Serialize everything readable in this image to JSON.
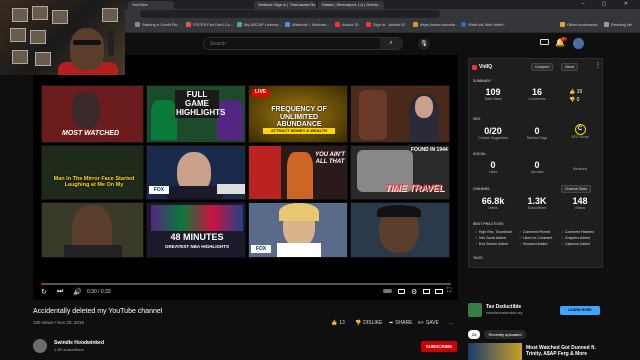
{
  "browser": {
    "tabs": [
      "YouTube",
      "Webinar Sign in | Thomasina Ro...",
      "Dallas | Shreveport, LA | Global...",
      ""
    ],
    "bookmarks": [
      {
        "label": "Starting a Credit Re...",
        "color": "#888"
      },
      {
        "label": "FDCPA Fair Debt Co...",
        "color": "#d55"
      },
      {
        "label": "My ASCAP License...",
        "color": "#4a8"
      },
      {
        "label": "Webmail :: Welcom...",
        "color": "#58c"
      },
      {
        "label": "Adobe ID",
        "color": "#e33"
      },
      {
        "label": "Sign in - Adobe ID",
        "color": "#e33"
      },
      {
        "label": "https://www.cfsonlin...",
        "color": "#c93"
      },
      {
        "label": "WebLink Web Interf...",
        "color": "#36a"
      },
      {
        "label": "Other bookmarks",
        "color": "#d9a441"
      },
      {
        "label": "Reading list",
        "color": "#999"
      }
    ]
  },
  "youtube": {
    "search_placeholder": "Search",
    "notif_count": "9+",
    "video": {
      "title": "Accidentally deleted my YouTube channel",
      "meta": "100 views • Nov 20, 2019",
      "time": "0:30 / 0:33",
      "likes": "13",
      "dislike_label": "DISLIKE",
      "share_label": "SHARE",
      "save_label": "SAVE",
      "more_label": "..."
    },
    "channel": {
      "name": "Swindle Hoodwinked",
      "subs": "1.5K subscribers"
    },
    "subscribe_label": "SUBSCRIBE"
  },
  "thumbnails": [
    {
      "text": "MOST WATCHED",
      "bg": "#6b1d1d",
      "color": "#fff"
    },
    {
      "text": "FULL GAME HIGHLIGHTS",
      "bg": "#1d4a2a",
      "color": "#fff"
    },
    {
      "text": "LIVE",
      "sub": "FREQUENCY OF UNLIMITED ABUNDANCE",
      "sub2": "ATTRACT MONEY & WEALTH",
      "bg": "#3a2a00",
      "color": "#ffd700"
    },
    {
      "text": "",
      "bg": "#4a2a1a",
      "color": "#fff"
    },
    {
      "text": "Man In The Mirror Face Started Laughing at Me On My",
      "bg": "#1f2a1a",
      "color": "#ffd700"
    },
    {
      "text": "",
      "bg": "#1a2a4a",
      "color": "#fff"
    },
    {
      "text": "YOU AIN'T ALL THAT",
      "bg": "#2a1a1a",
      "color": "#fff"
    },
    {
      "text": "TIME TRAVEL",
      "sub": "FOUND IN 1944",
      "bg": "#2a2a2a",
      "color": "#e33"
    },
    {
      "text": "",
      "bg": "#3a3a2a",
      "color": "#fff"
    },
    {
      "text": "48 MINUTES",
      "sub": "GREATEST NBA HIGHLIGHTS",
      "bg": "#1a1a2a",
      "color": "#fff"
    },
    {
      "text": "",
      "bg": "#4a4a5a",
      "color": "#fff"
    },
    {
      "text": "",
      "bg": "#2a3a4a",
      "color": "#fff"
    }
  ],
  "vidiq": {
    "brand": "VidIQ",
    "btn_compare": "Compare",
    "btn_views": "Views",
    "summary_label": "SUMMARY",
    "summary": [
      {
        "value": "109",
        "cap": "Total Views"
      },
      {
        "value": "16",
        "cap": "Comments"
      },
      {
        "value": "19",
        "cap": ""
      }
    ],
    "seo_label": "SEO",
    "seo": [
      {
        "value": "0/20",
        "cap": "Creator Suggested"
      },
      {
        "value": "0",
        "cap": "Ranked Tags"
      },
      {
        "value": "C",
        "cap": "SEO Score"
      }
    ],
    "social_label": "SOCIAL",
    "social": [
      {
        "value": "0",
        "cap": "Likes"
      },
      {
        "value": "0",
        "cap": "Upvotes"
      },
      {
        "value": "",
        "cap": "Mentions"
      }
    ],
    "channel_label": "CHANNEL",
    "channel_btn": "Channel Stats",
    "channel": [
      {
        "value": "66.8k",
        "cap": "Views"
      },
      {
        "value": "1.3K",
        "cap": "Subscribers"
      },
      {
        "value": "148",
        "cap": "Videos"
      }
    ],
    "best_label": "BEST PRACTICES",
    "best": [
      "High Res. Thumbnail",
      "Comment Pinned",
      "Comment Hearted",
      "Info Cards Added",
      "Liked on Comment",
      "Chapters Added",
      "End Screen Added",
      "Keyword Added",
      "Captions Added"
    ],
    "tags_label": "TAGS"
  },
  "ad": {
    "title": "Tax Deductible",
    "sub": "swindlehoodwinked.org",
    "btn": "LEARN MORE"
  },
  "chips": [
    "All",
    "Recently uploaded"
  ],
  "rec": {
    "title": "Most Watched Got Dunned ft. Trinity, A$AP Ferg & More"
  }
}
